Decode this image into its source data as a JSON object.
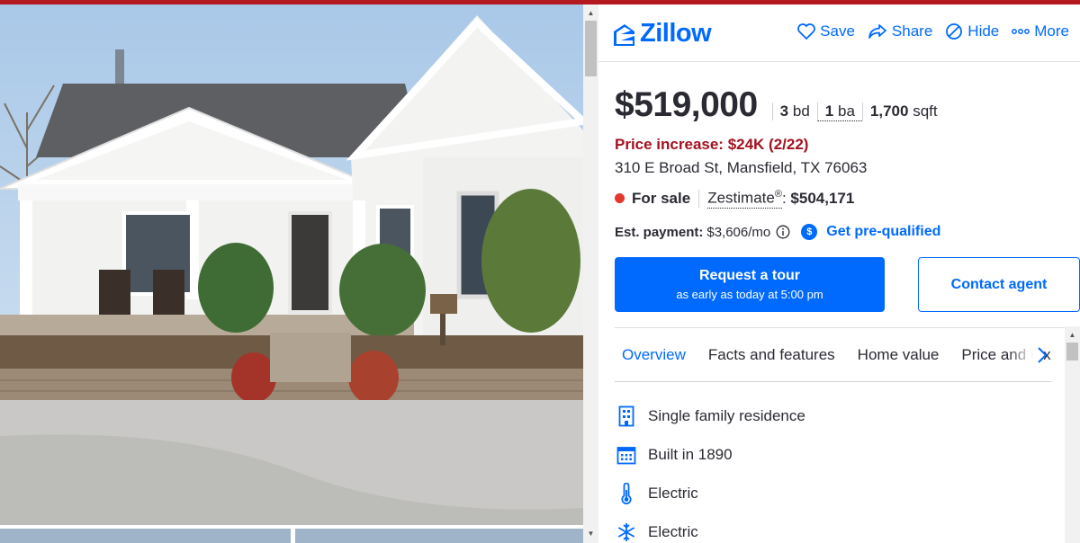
{
  "header": {
    "logo_text": "Zillow",
    "actions": [
      {
        "label": "Save",
        "icon": "heart-icon"
      },
      {
        "label": "Share",
        "icon": "share-icon"
      },
      {
        "label": "Hide",
        "icon": "hide-icon"
      },
      {
        "label": "More",
        "icon": "more-icon"
      }
    ]
  },
  "listing": {
    "price": "$519,000",
    "beds_value": "3",
    "beds_label": "bd",
    "baths_value": "1",
    "baths_label": "ba",
    "sqft_value": "1,700",
    "sqft_label": "sqft",
    "price_change": "Price increase: $24K (2/22)",
    "address": "310 E Broad St, Mansfield, TX 76063",
    "status": "For sale",
    "zestimate_label": "Zestimate",
    "zestimate_mark": "®",
    "zestimate_colon": ":",
    "zestimate_value": "$504,171",
    "payment_label": "Est. payment:",
    "payment_value": "$3,606/mo",
    "prequal_label": "Get pre-qualified"
  },
  "buttons": {
    "tour_line1": "Request a tour",
    "tour_line2": "as early as today at 5:00 pm",
    "contact": "Contact agent"
  },
  "tabs": [
    "Overview",
    "Facts and features",
    "Home value",
    "Price and tax h"
  ],
  "features": [
    {
      "icon": "building-icon",
      "text": "Single family residence"
    },
    {
      "icon": "calendar-icon",
      "text": "Built in 1890"
    },
    {
      "icon": "thermometer-icon",
      "text": "Electric"
    },
    {
      "icon": "snowflake-icon",
      "text": "Electric"
    }
  ],
  "colors": {
    "brand": "#006aff",
    "price_increase": "#a3111f",
    "status_dot": "#e5382d",
    "top_strip": "#b4191f"
  }
}
